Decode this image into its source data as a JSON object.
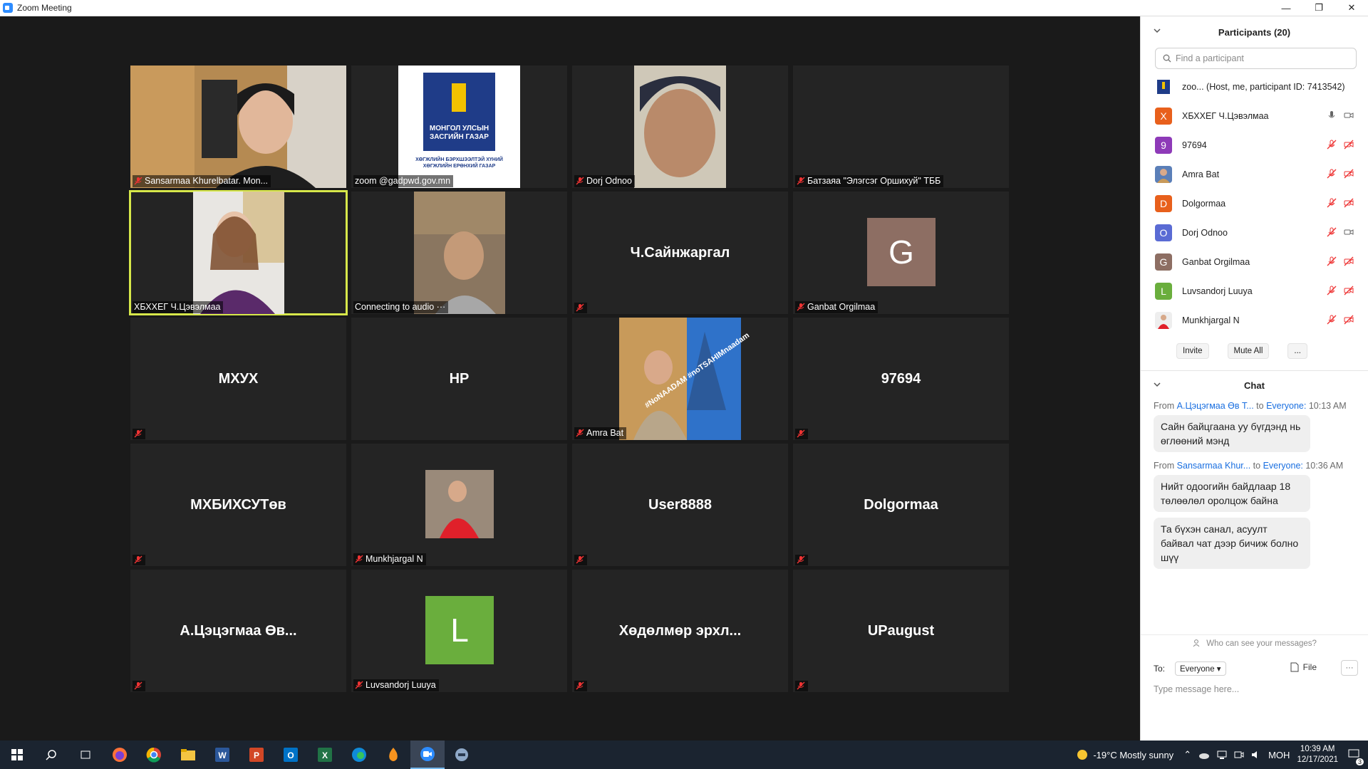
{
  "window": {
    "title": "Zoom Meeting"
  },
  "tiles": [
    {
      "label": "Sansarmaa Khurelbatar. Mon...",
      "center": ""
    },
    {
      "label": "zoom @gadpwd.gov.mn",
      "center": "",
      "logo_text_1": "МОНГОЛ УЛСЫН",
      "logo_text_2": "ЗАСГИЙН ГАЗАР",
      "logo_text_3": "ХӨГЖЛИЙН БЭРХШЭЭЛТЭЙ ХҮНИЙ",
      "logo_text_4": "ХӨГЖЛИЙН ЕРӨНХИЙ ГАЗАР"
    },
    {
      "label": "Dorj Odnoo",
      "center": ""
    },
    {
      "label": "Батзаяа \"Элэгсэг Оршихуй\" ТББ",
      "center": ""
    },
    {
      "label": "ХБХХЕГ Ч.Цэвэлмаа",
      "center": ""
    },
    {
      "label": "Connecting to audio ···",
      "center": ""
    },
    {
      "label": "",
      "center": "Ч.Сайнжаргал"
    },
    {
      "label": "Ganbat Orgilmaa",
      "center": "",
      "avatar_letter": "G"
    },
    {
      "label": "",
      "center": "МХУХ"
    },
    {
      "label": "",
      "center": "HP"
    },
    {
      "label": "Amra Bat",
      "center": "",
      "banner_text": "#NoNAADAM #noTSAHIMnaadam"
    },
    {
      "label": "",
      "center": "97694"
    },
    {
      "label": "",
      "center": "МХБИХСУТөв"
    },
    {
      "label": "Munkhjargal N",
      "center": ""
    },
    {
      "label": "",
      "center": "User8888"
    },
    {
      "label": "",
      "center": "Dolgormaa"
    },
    {
      "label": "",
      "center": "А.Цэцэгмаа Өв..."
    },
    {
      "label": "Luvsandorj Luuya",
      "center": "",
      "avatar_letter": "L"
    },
    {
      "label": "",
      "center": "Хөдөлмөр эрхл..."
    },
    {
      "label": "",
      "center": "UPaugust"
    }
  ],
  "participants": {
    "title": "Participants (20)",
    "search_placeholder": "Find a participant",
    "list": [
      {
        "name": "zoo...  (Host, me, participant ID: 7413542)",
        "avatar": "",
        "color": "#1f3c88"
      },
      {
        "name": "ХБХХЕГ Ч.Цэвэлмаа",
        "avatar": "Х",
        "color": "#e8601c"
      },
      {
        "name": "97694",
        "avatar": "9",
        "color": "#8e3ab8"
      },
      {
        "name": "Amra Bat",
        "avatar": "",
        "color": "#5b7fb8"
      },
      {
        "name": "Dolgormaa",
        "avatar": "D",
        "color": "#e8601c"
      },
      {
        "name": "Dorj Odnoo",
        "avatar": "O",
        "color": "#5a6bd4"
      },
      {
        "name": "Ganbat Orgilmaa",
        "avatar": "G",
        "color": "#8d6e63"
      },
      {
        "name": "Luvsandorj Luuya",
        "avatar": "L",
        "color": "#6aae3d"
      },
      {
        "name": "Munkhjargal N",
        "avatar": "",
        "color": "#c0392b"
      }
    ],
    "invite": "Invite",
    "mute_all": "Mute All",
    "more": "..."
  },
  "chat": {
    "title": "Chat",
    "messages": [
      {
        "from_label": "From",
        "from": "А.Цэцэгмаа Өв Т...",
        "to_label": "to",
        "to": "Everyone:",
        "time": "10:13 AM",
        "texts": [
          "Сайн байцгаана уу бүгдэнд нь өглөөний мэнд"
        ]
      },
      {
        "from_label": "From",
        "from": "Sansarmaa Khur...",
        "to_label": "to",
        "to": "Everyone:",
        "time": "10:36 AM",
        "texts": [
          "Нийт одоогийн байдлаар 18 төлөөлөл оролцож байна",
          "Та бүхэн санал, асуулт байвал чат дээр бичиж болно шүү"
        ]
      }
    ],
    "who_see": "Who can see your messages?",
    "to": "To:",
    "to_value": "Everyone",
    "file": "File",
    "more": "···",
    "input_placeholder": "Type message here..."
  },
  "taskbar": {
    "weather": "-19°C  Mostly sunny",
    "lang": "МОН",
    "time": "10:39 AM",
    "date": "12/17/2021",
    "notif_count": "3"
  }
}
